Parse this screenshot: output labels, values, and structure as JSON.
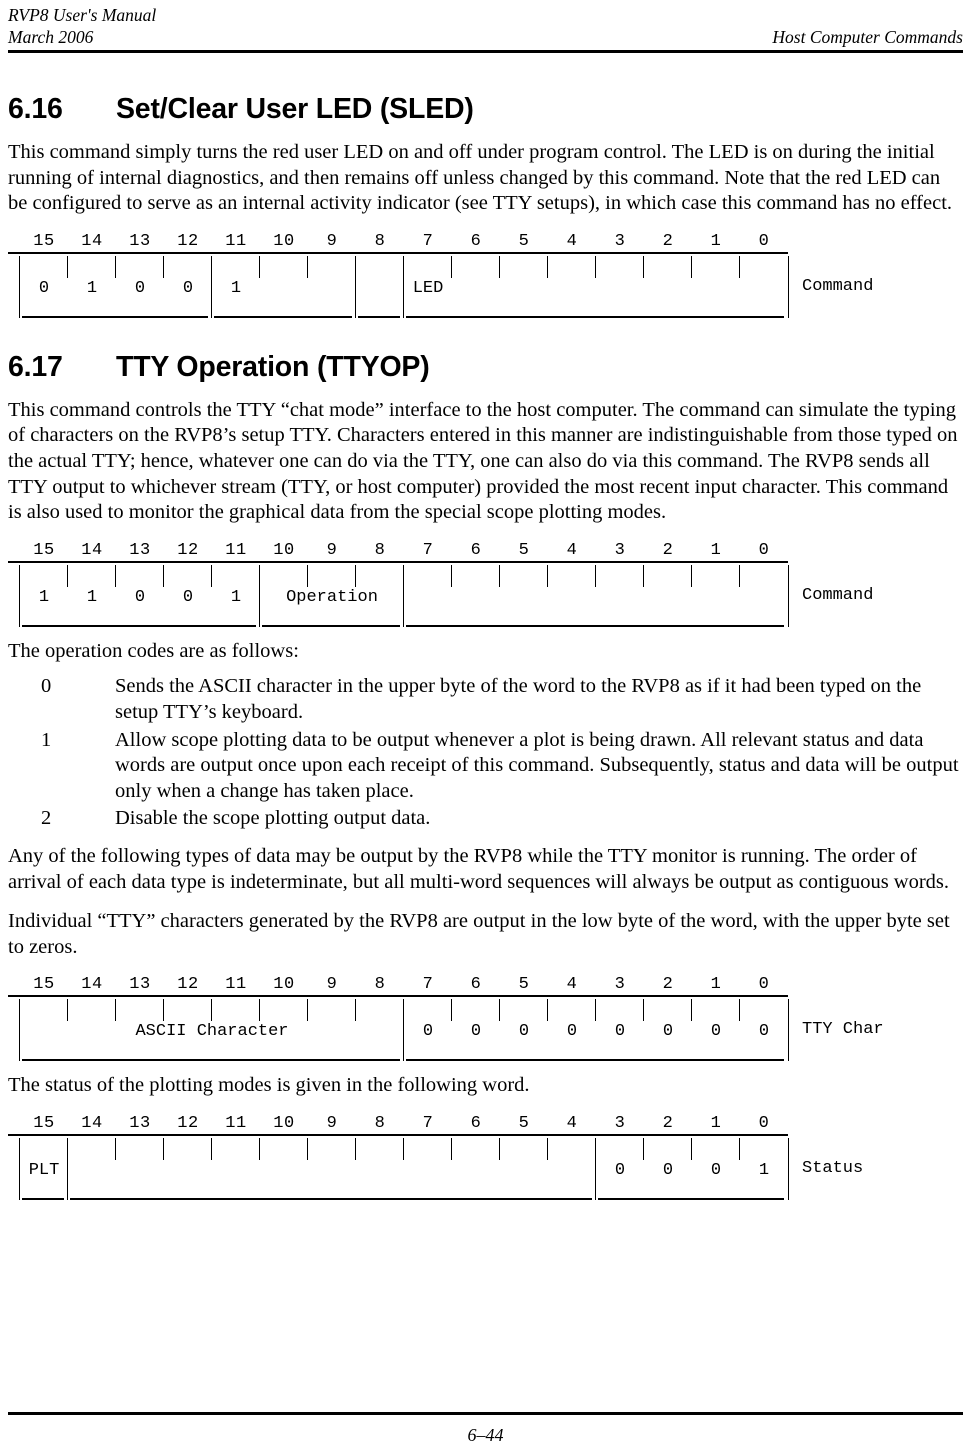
{
  "header": {
    "manual_title": "RVP8 User's Manual",
    "date": "March 2006",
    "chapter_title": "Host Computer Commands"
  },
  "footer": {
    "page_number": "6–44"
  },
  "sections": [
    {
      "number": "6.16",
      "title": "Set/Clear User LED (SLED)",
      "paragraph": "This command simply turns the red user LED on and off under program control.  The LED is on during the initial running of internal diagnostics, and then remains off unless changed by this command.  Note that the red LED can be configured to serve as an internal activity indicator (see TTY setups), in which case this command has no effect."
    },
    {
      "number": "6.17",
      "title": "TTY Operation (TTYOP)",
      "paragraph": "This command controls the TTY “chat mode” interface to the host computer.  The command can simulate the typing of characters on the RVP8’s setup TTY.  Characters entered in this manner are indistinguishable from those typed on the actual TTY; hence, whatever one can do via the TTY, one can also do via this command.  The RVP8 sends all TTY output to whichever stream (TTY, or host computer) provided the most recent input character.  This command is also used to monitor the graphical data from the special scope plotting modes."
    }
  ],
  "opcodes_intro": "The operation codes are as follows:",
  "opcodes": [
    {
      "code": "0",
      "description": "Sends the ASCII character in the upper byte of the word to the RVP8 as if it had been typed on the setup TTY’s keyboard."
    },
    {
      "code": "1",
      "description": "Allow scope plotting data to be output whenever a plot is being drawn.  All relevant status and data words are output once upon each receipt of this command.  Subsequently, status and data will be output only when a change has taken place."
    },
    {
      "code": "2",
      "description": "Disable the scope plotting output data."
    }
  ],
  "paragraph_after_opcodes": "Any of the following types of data may be output by the RVP8 while the TTY monitor is running.  The order of arrival of each data type is indeterminate, but all multi-word sequences will always be output as contiguous words.",
  "paragraph_tty_chars": "Individual “TTY” characters generated by the RVP8 are output in the low byte of the word, with the upper byte set to zeros.",
  "paragraph_status": "The status of the plotting modes is given in the following word.",
  "bit_numbers": [
    "15",
    "14",
    "13",
    "12",
    "11",
    "10",
    "9",
    "8",
    "7",
    "6",
    "5",
    "4",
    "3",
    "2",
    "1",
    "0"
  ],
  "diagrams": [
    {
      "id": "sled-command",
      "name": "Command",
      "bits": [
        "",
        "",
        "",
        "",
        "",
        "",
        "",
        "LED",
        "",
        "",
        "",
        "1",
        "0",
        "0",
        "1",
        "0"
      ],
      "fields": [
        {
          "start": 0,
          "end": 7,
          "label": ""
        },
        {
          "start": 8,
          "end": 8,
          "label": "LED"
        },
        {
          "start": 9,
          "end": 11,
          "label": ""
        },
        {
          "start": 12,
          "end": 15,
          "label": ""
        }
      ]
    },
    {
      "id": "ttyop-command",
      "name": "Command",
      "bits": [
        "",
        "",
        "",
        "",
        "",
        "",
        "",
        "",
        "",
        "",
        "",
        "1",
        "0",
        "0",
        "1",
        "1"
      ],
      "span_labels": [
        {
          "text": "Operation",
          "start": 8,
          "end": 10
        }
      ],
      "fields": [
        {
          "start": 0,
          "end": 7,
          "label": ""
        },
        {
          "start": 8,
          "end": 10,
          "label": "Operation"
        },
        {
          "start": 11,
          "end": 15,
          "label": ""
        }
      ]
    },
    {
      "id": "tty-char",
      "name": "TTY Char",
      "bits": [
        "0",
        "0",
        "0",
        "0",
        "0",
        "0",
        "0",
        "0",
        "",
        "",
        "",
        "",
        "",
        "",
        "",
        ""
      ],
      "span_labels": [
        {
          "text": "ASCII Character",
          "start": 8,
          "end": 15
        }
      ],
      "fields": [
        {
          "start": 0,
          "end": 7,
          "label": ""
        },
        {
          "start": 8,
          "end": 15,
          "label": "ASCII Character"
        }
      ]
    },
    {
      "id": "plot-status",
      "name": "Status",
      "bits": [
        "1",
        "0",
        "0",
        "0",
        "",
        "",
        "",
        "",
        "",
        "",
        "",
        "",
        "",
        "",
        "",
        "PLT"
      ],
      "fields": [
        {
          "start": 0,
          "end": 3,
          "label": ""
        },
        {
          "start": 4,
          "end": 14,
          "label": ""
        },
        {
          "start": 15,
          "end": 15,
          "label": "PLT"
        }
      ]
    }
  ]
}
